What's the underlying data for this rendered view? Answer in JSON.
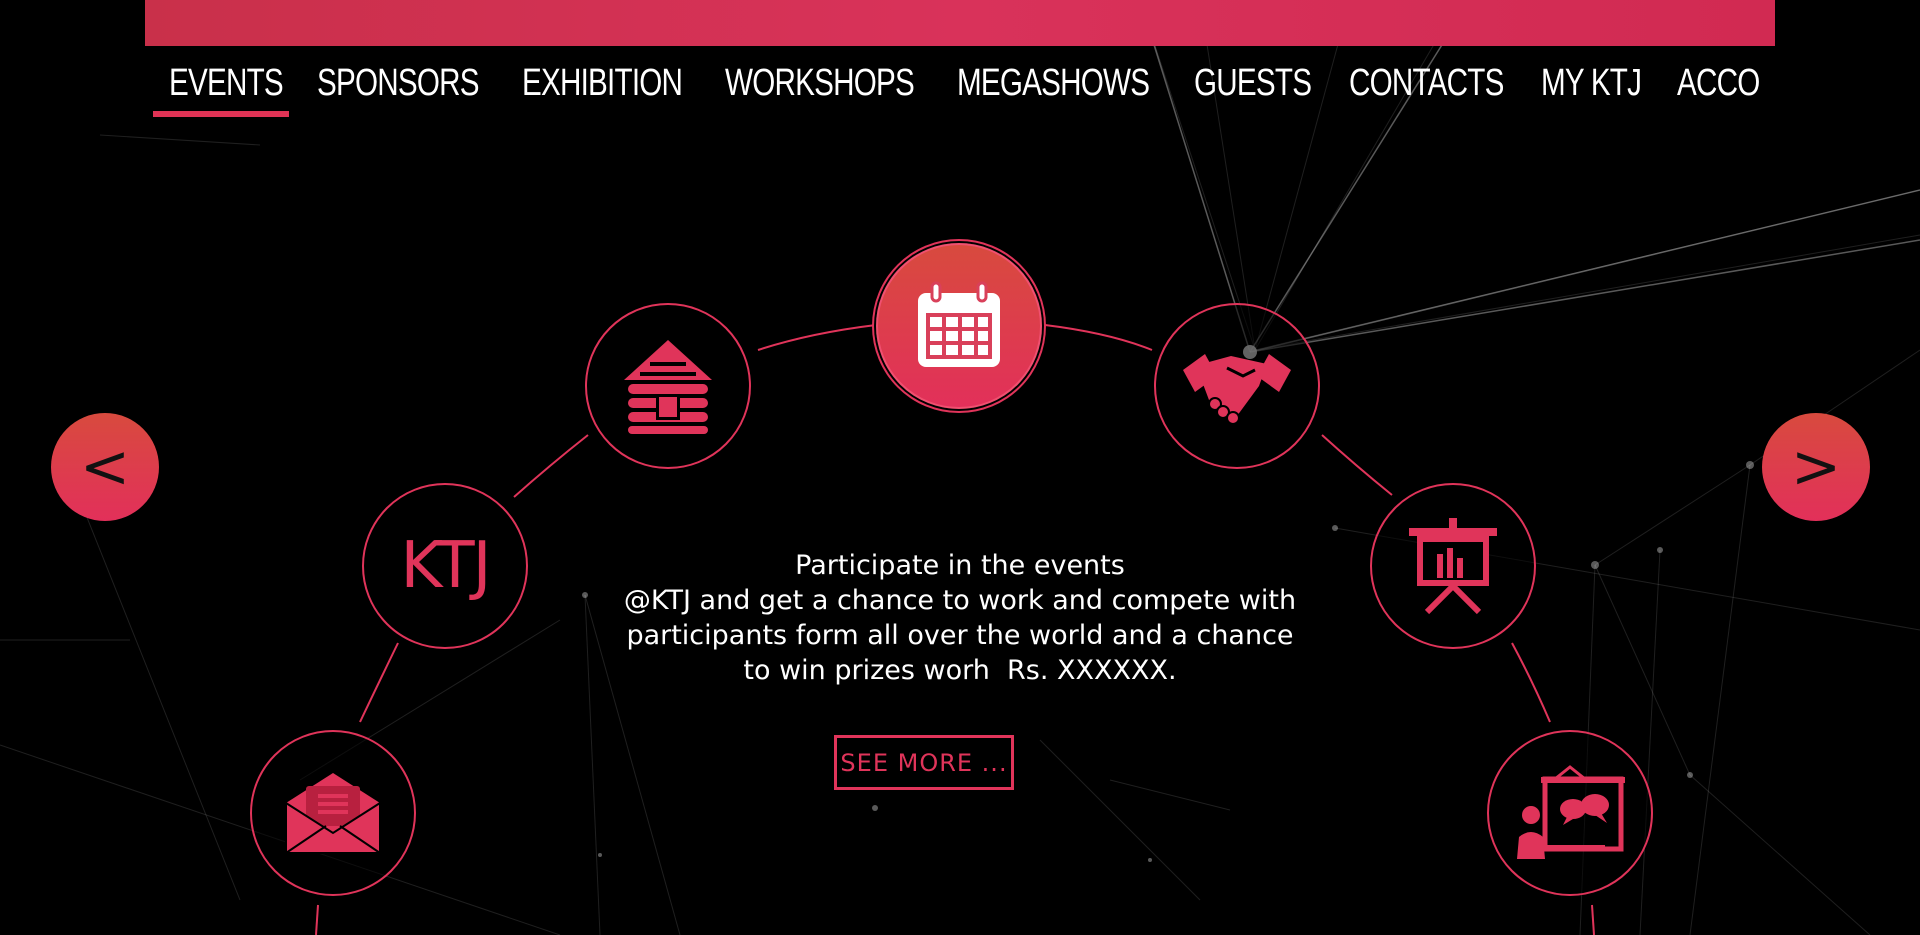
{
  "nav": {
    "items": [
      {
        "label": "EVENTS",
        "active": true
      },
      {
        "label": "SPONSORS"
      },
      {
        "label": "EXHIBITION"
      },
      {
        "label": "WORKSHOPS"
      },
      {
        "label": "MEGASHOWS"
      },
      {
        "label": "GUESTS"
      },
      {
        "label": "CONTACTS"
      },
      {
        "label": "MY KTJ"
      },
      {
        "label": "ACCO"
      }
    ]
  },
  "carousel": {
    "prev_label": "<",
    "next_label": ">",
    "nodes": [
      {
        "icon": "envelope-icon"
      },
      {
        "icon": "ktj-logo",
        "text": "KTJ"
      },
      {
        "icon": "log-cabin-icon"
      },
      {
        "icon": "calendar-icon",
        "active": true
      },
      {
        "icon": "handshake-icon"
      },
      {
        "icon": "presentation-board-icon"
      },
      {
        "icon": "speaker-presentation-icon"
      }
    ]
  },
  "description": {
    "lines": [
      "Participate in the events",
      "@KTJ and get a chance to work and compete with",
      "participants form all over the world and a chance",
      "to win prizes worh  Rs. XXXXXX."
    ]
  },
  "see_more_label": "SEE MORE ...",
  "colors": {
    "accent": "#e0345a",
    "accent_orange": "#d84a3e",
    "background": "#000000"
  }
}
